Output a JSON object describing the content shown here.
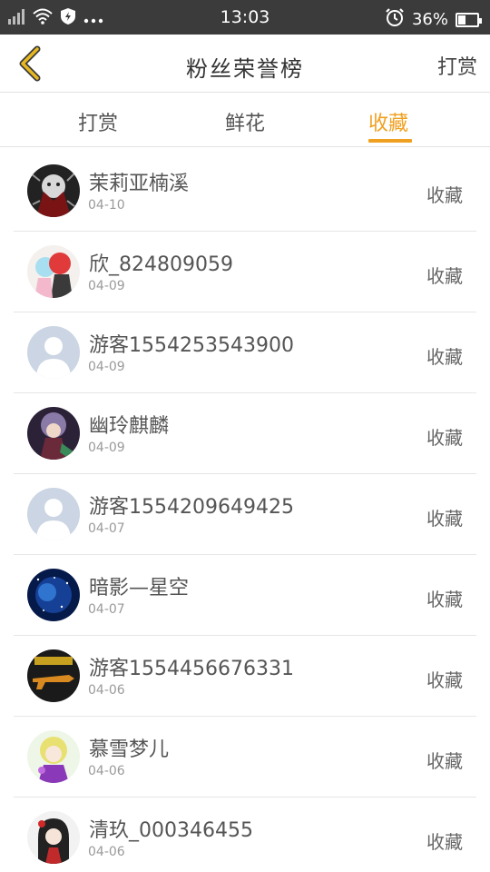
{
  "status_bar": {
    "time": "13:03",
    "battery": "36%"
  },
  "header": {
    "title": "粉丝荣誉榜",
    "right_label": "打赏"
  },
  "tabs": [
    {
      "label": "打赏"
    },
    {
      "label": "鲜花"
    },
    {
      "label": "收藏"
    }
  ],
  "active_tab": 2,
  "colors": {
    "accent": "#f0a020",
    "back_arrow": "#e8b820"
  },
  "fans": [
    {
      "name": "茉莉亚楠溪",
      "date": "04-10",
      "action": "收藏"
    },
    {
      "name": "欣_824809059",
      "date": "04-09",
      "action": "收藏"
    },
    {
      "name": "游客1554253543900",
      "date": "04-09",
      "action": "收藏"
    },
    {
      "name": "幽玲麒麟",
      "date": "04-09",
      "action": "收藏"
    },
    {
      "name": "游客1554209649425",
      "date": "04-07",
      "action": "收藏"
    },
    {
      "name": "暗影—星空",
      "date": "04-07",
      "action": "收藏"
    },
    {
      "name": "游客1554456676331",
      "date": "04-06",
      "action": "收藏"
    },
    {
      "name": "慕雪梦儿",
      "date": "04-06",
      "action": "收藏"
    },
    {
      "name": "清玖_000346455",
      "date": "04-06",
      "action": "收藏"
    }
  ]
}
